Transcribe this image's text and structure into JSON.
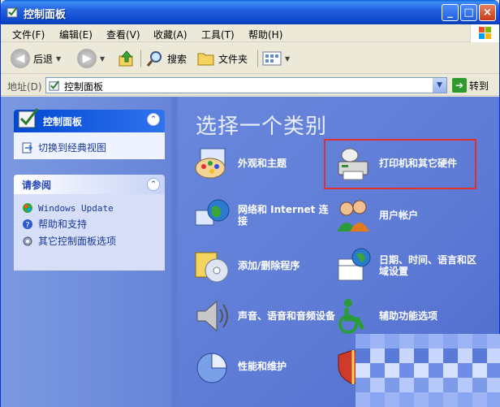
{
  "window": {
    "title": "控制面板",
    "buttons": {
      "minimize": "_",
      "maximize": "□",
      "close": "×"
    }
  },
  "menu": [
    {
      "label": "文件(F)"
    },
    {
      "label": "编辑(E)"
    },
    {
      "label": "查看(V)"
    },
    {
      "label": "收藏(A)"
    },
    {
      "label": "工具(T)"
    },
    {
      "label": "帮助(H)"
    }
  ],
  "toolbar": {
    "back": "后退",
    "search": "搜索",
    "folders": "文件夹"
  },
  "address": {
    "label": "地址(D)",
    "value": "控制面板",
    "go": "转到"
  },
  "sidebar": {
    "panel1": {
      "title": "控制面板",
      "links": [
        {
          "label": "切换到经典视图"
        }
      ]
    },
    "panel2": {
      "title": "请参阅",
      "links": [
        {
          "label": "Windows Update"
        },
        {
          "label": "帮助和支持"
        },
        {
          "label": "其它控制面板选项"
        }
      ]
    }
  },
  "main": {
    "heading": "选择一个类别",
    "categories": [
      {
        "label": "外观和主题"
      },
      {
        "label": "打印机和其它硬件"
      },
      {
        "label": "网络和 Internet 连接"
      },
      {
        "label": "用户帐户"
      },
      {
        "label": "添加/删除程序"
      },
      {
        "label": "日期、时间、语言和区域设置"
      },
      {
        "label": "声音、语音和音频设备"
      },
      {
        "label": "辅助功能选项"
      },
      {
        "label": "性能和维护"
      }
    ]
  },
  "colors": {
    "titlebar": "#0a46c8",
    "content_bg": "#6a87dd",
    "highlight_border": "#e03030"
  }
}
